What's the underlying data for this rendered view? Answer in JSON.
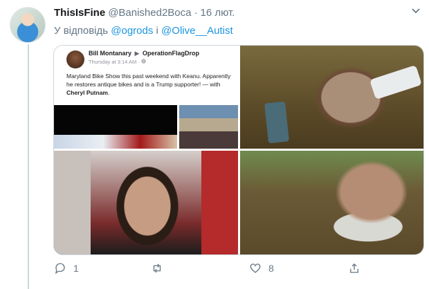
{
  "tweet": {
    "display_name": "ThisIsFine",
    "handle": "@Banished2Boca",
    "separator": "·",
    "time": "16 лют.",
    "reply_prefix": "У відповідь",
    "reply_user1": "@ogrods",
    "reply_joiner": "і",
    "reply_user2": "@Olive__Autist"
  },
  "embedded_post": {
    "author": "Bill Montanary",
    "arrow": "▶",
    "group": "OperationFlagDrop",
    "timestamp": "Thursday at 3:14 AM · ",
    "text": "Maryland Bike Show this past weekend with Keanu. Apparently he restores antique bikes and is a Trump supporter! — with ",
    "tagged": "Cheryl Putnam",
    "text_end": "."
  },
  "actions": {
    "reply_count": "1",
    "retweet_count": "",
    "like_count": "8"
  },
  "icons": [
    "chevron-down-icon",
    "reply-icon",
    "retweet-icon",
    "like-icon",
    "share-icon"
  ],
  "colors": {
    "link": "#1b95e0",
    "muted": "#657786"
  }
}
